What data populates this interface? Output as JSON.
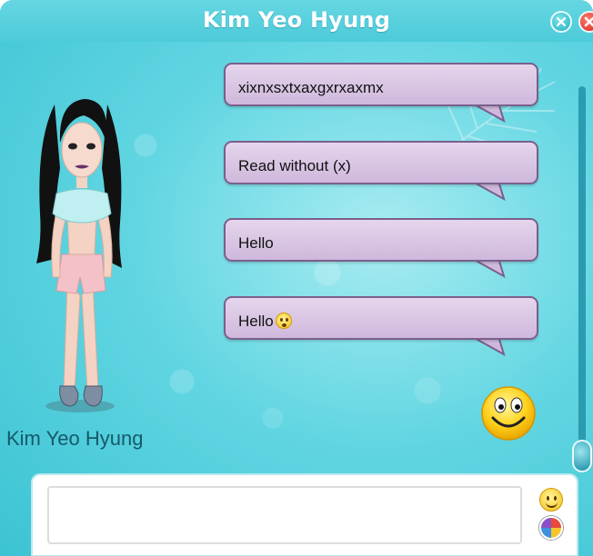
{
  "window": {
    "title": "Kim Yeo Hyung"
  },
  "titlebar_buttons": {
    "minimize_icon": "circle-x-icon",
    "close_icon": "close-icon"
  },
  "profile": {
    "name": "Kim Yeo Hyung",
    "avatar_icon": "avatar-figure"
  },
  "messages": [
    {
      "text": "xixnxsxtxaxgxrxaxmx",
      "emoji": ""
    },
    {
      "text": "Read without (x)",
      "emoji": ""
    },
    {
      "text": "Hello",
      "emoji": ""
    },
    {
      "text": "Hello",
      "emoji": "worried-face-icon"
    }
  ],
  "status_emoji": "big-smiley-icon",
  "composer": {
    "value": "",
    "placeholder": "",
    "emoji_button_icon": "smiley-icon",
    "color_button_icon": "color-wheel-icon"
  },
  "colors": {
    "background": "#62d6e2",
    "bubble": "#d9c4e4",
    "bubble_border": "#7a5f8c",
    "close": "#d8261a"
  }
}
